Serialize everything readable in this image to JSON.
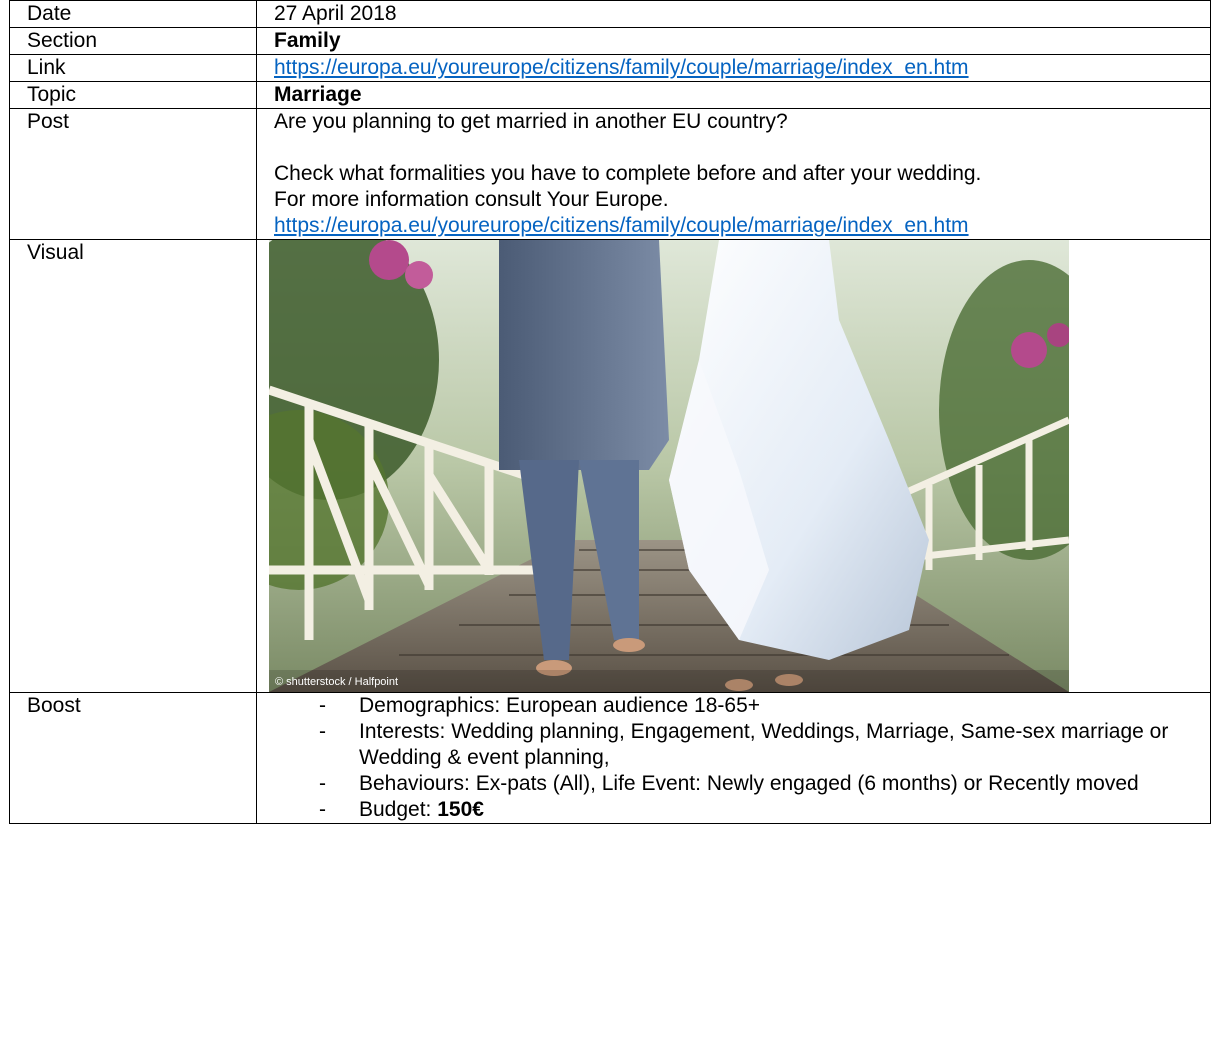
{
  "rows": {
    "date": {
      "label": "Date",
      "value": "27 April 2018"
    },
    "section": {
      "label": "Section",
      "value": "Family"
    },
    "link": {
      "label": "Link",
      "value": "https://europa.eu/youreurope/citizens/family/couple/marriage/index_en.htm"
    },
    "topic": {
      "label": "Topic",
      "value": "Marriage"
    },
    "post": {
      "label": "Post",
      "line1": "Are you planning to get married in another EU country?",
      "line2": "Check what formalities you have to complete before and after your wedding.",
      "line3": "For more information consult Your Europe.",
      "url": "https://europa.eu/youreurope/citizens/family/couple/marriage/index_en.htm"
    },
    "visual": {
      "label": "Visual",
      "credit": "© shutterstock / Halfpoint"
    },
    "boost": {
      "label": "Boost",
      "items": {
        "demographics": "Demographics: European audience 18-65+",
        "interests": "Interests: Wedding planning, Engagement, Weddings, Marriage, Same-sex marriage or Wedding & event planning,",
        "behaviours": "Behaviours: Ex-pats (All), Life Event: Newly engaged (6 months) or Recently moved",
        "budget_label": "Budget: ",
        "budget_value": "150€"
      },
      "bullet": "-"
    }
  },
  "colors": {
    "link": "#0563c1",
    "border": "#000000"
  }
}
